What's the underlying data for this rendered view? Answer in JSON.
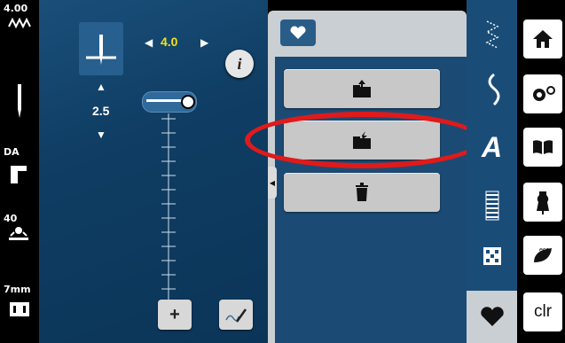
{
  "left_status": {
    "stitch_width": "4.00",
    "presser_foot": "DA",
    "tension": "40",
    "stitch_length": "7mm"
  },
  "main": {
    "width_value": "4.0",
    "length_value": "2.5",
    "slider_level": 0.92
  },
  "panel_buttons": [
    {
      "name": "save-to-machine",
      "icon": "folder-upload-icon"
    },
    {
      "name": "load-from-machine",
      "icon": "folder-download-icon"
    },
    {
      "name": "delete",
      "icon": "trash-icon"
    }
  ],
  "tabs": {
    "text_tab_label": "A"
  },
  "nav": {
    "clr_label": "clr"
  },
  "colors": {
    "accent_yellow": "#f2e21a",
    "highlight_red": "#e01a1a"
  }
}
